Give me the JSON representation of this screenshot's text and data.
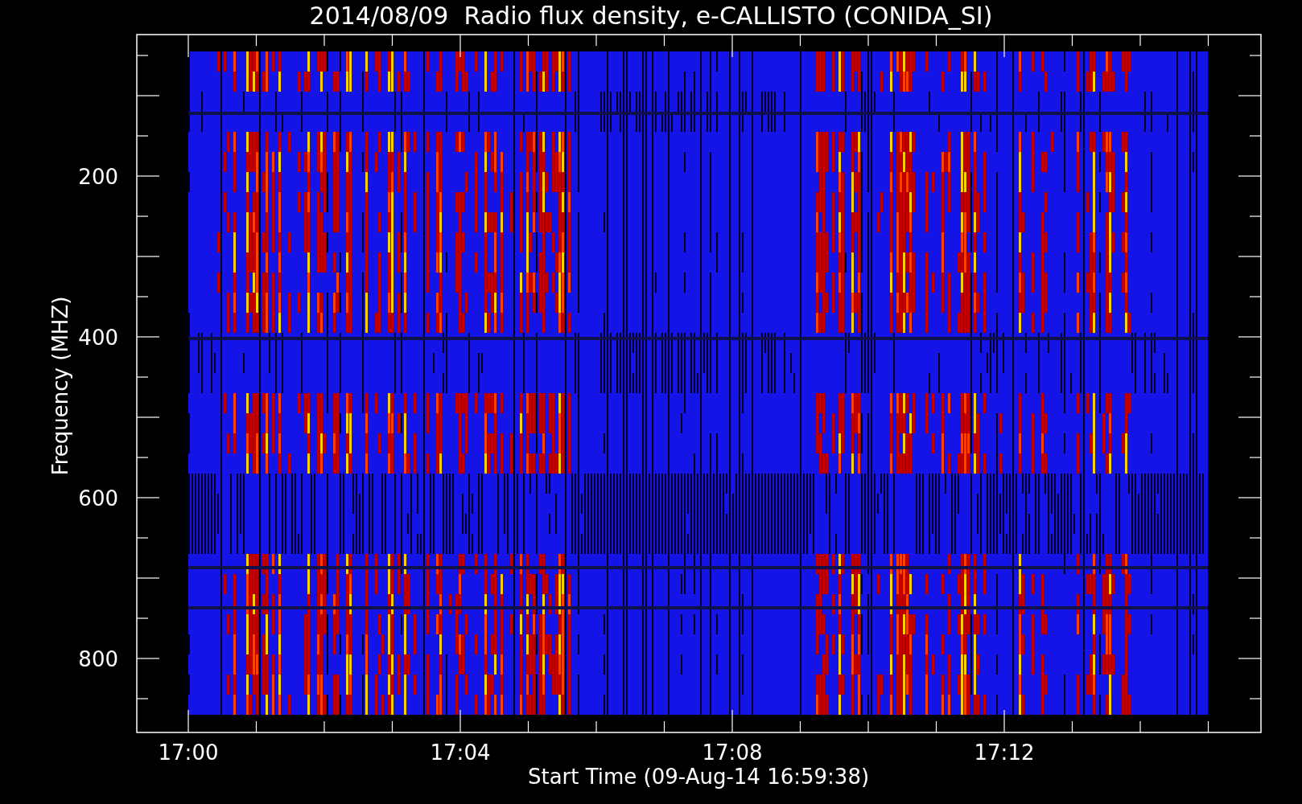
{
  "title": "2014/08/09  Radio flux density, e-CALLISTO (CONIDA_SI)",
  "plot": {
    "ylabel": "Frequency (MHZ)",
    "xlabel": "Start Time (09-Aug-14 16:59:38)",
    "yticks": [
      "200",
      "400",
      "600",
      "800"
    ],
    "xticks": [
      "17:00",
      "17:04",
      "17:08",
      "17:12"
    ]
  }
}
